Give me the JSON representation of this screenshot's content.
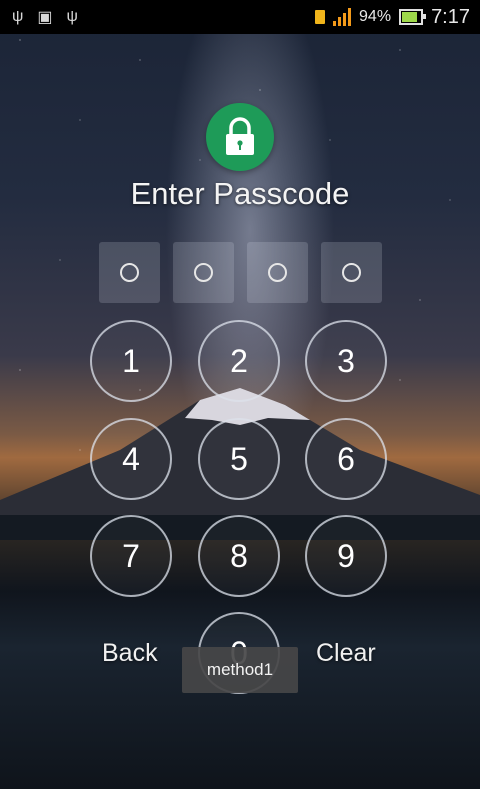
{
  "status_bar": {
    "left_icons": [
      "usb-icon",
      "android-icon",
      "usb-icon"
    ],
    "battery_percent": "94%",
    "time": "7:17",
    "signal_color": "#f39a1a",
    "battery_level": 0.94
  },
  "lock_screen": {
    "badge_color": "#1e9b58",
    "title": "Enter Passcode",
    "passcode_slots": 4,
    "keys": [
      "1",
      "2",
      "3",
      "4",
      "5",
      "6",
      "7",
      "8",
      "9",
      "0"
    ],
    "back_label": "Back",
    "clear_label": "Clear"
  },
  "toast": {
    "text": "method1"
  }
}
